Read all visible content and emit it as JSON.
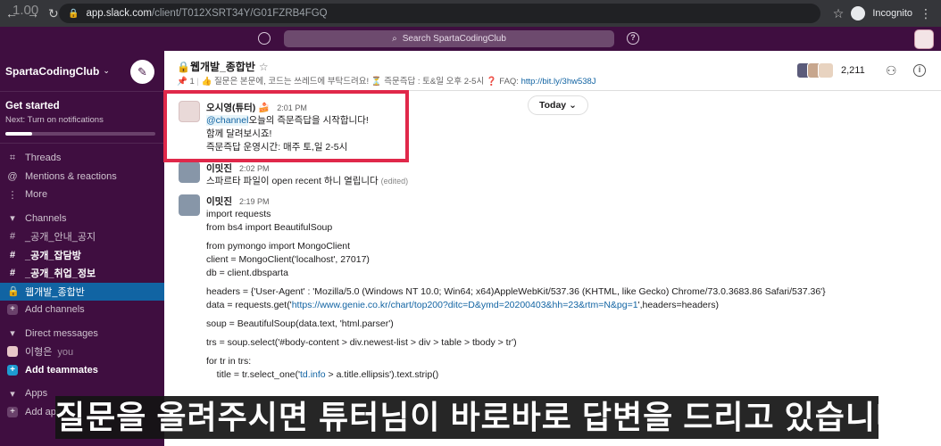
{
  "browser": {
    "url_host": "app.slack.com",
    "url_path": "/client/T012XSRT34Y/G01FZRB4FGQ",
    "profile": "Incognito",
    "overlay_version": "1.00"
  },
  "slack_top": {
    "search_placeholder": "Search SpartaCodingClub"
  },
  "sidebar": {
    "workspace": "SpartaCodingClub",
    "get_started_title": "Get started",
    "get_started_sub": "Next: Turn on notifications",
    "get_started_progress": 0.18,
    "nav": [
      {
        "label": "Threads",
        "icon": "threads-icon"
      },
      {
        "label": "Mentions & reactions",
        "icon": "at-icon"
      },
      {
        "label": "More",
        "icon": "more-icon"
      }
    ],
    "channels_header": "Channels",
    "channels": [
      {
        "label": "_공개_안내_공지",
        "bold": false,
        "active": false,
        "prefix": "#"
      },
      {
        "label": "_공개_잡담방",
        "bold": true,
        "active": false,
        "prefix": "#"
      },
      {
        "label": "_공개_취업_정보",
        "bold": true,
        "active": false,
        "prefix": "#"
      },
      {
        "label": "웹개발_종합반",
        "bold": false,
        "active": true,
        "prefix": "🔒"
      }
    ],
    "add_channels": "Add channels",
    "dm_header": "Direct messages",
    "dm_user": "이형은",
    "dm_you": "you",
    "add_teammates": "Add teammates",
    "apps_header": "Apps",
    "add_apps": "Add apps"
  },
  "channel": {
    "name": "웹개발_종합반",
    "topic_count": "1",
    "topic_text": "👍 질문은 본문에, 코드는 쓰레드에 부탁드려요! ⏳ 즉문즉답 : 토&일 오후 2-5시 ❓ FAQ: ",
    "topic_link": "http://bit.ly/3hw538J",
    "member_count": "2,211"
  },
  "today_label": "Today",
  "messages": {
    "m1": {
      "author": "오시영(튜터) 🍰",
      "time": "2:01 PM",
      "mention": "@channel",
      "line1_rest": "오늘의 즉문즉답을 시작합니다!",
      "line2": "함께 달려보시죠!",
      "line3": "즉문즉답 운영시간: 매주 토,일 2-5시"
    },
    "m2": {
      "author": "이밋진",
      "time": "2:02 PM",
      "line1": "스파르타 파일이 open recent 하니 열립니다",
      "edited": "(edited)"
    },
    "m3": {
      "author": "이밋진",
      "time": "2:19 PM",
      "c1": "import requests",
      "c2": "from bs4 import BeautifulSoup",
      "c3": "from pymongo import MongoClient",
      "c4": "client = MongoClient('localhost', 27017)",
      "c5": "db = client.dbsparta",
      "c6": "headers = {'User-Agent' : 'Mozilla/5.0 (Windows NT 10.0; Win64; x64)AppleWebKit/537.36 (KHTML, like Gecko) Chrome/73.0.3683.86 Safari/537.36'}",
      "c7_pre": "data = requests.get('",
      "c7_link": "https://www.genie.co.kr/chart/top200?ditc=D&ymd=20200403&hh=23&rtm=N&pg=1",
      "c7_post": "',headers=headers)",
      "c8": "soup = BeautifulSoup(data.text, 'html.parser')",
      "c9": "trs = soup.select('#body-content > div.newest-list > div > table > tbody > tr')",
      "c10": "for tr in trs:",
      "c11_pre": "    title = tr.select_one('",
      "c11_link": "td.info",
      "c11_post": " > a.title.ellipsis').text.strip()"
    }
  },
  "subtitle": "질문을 올려주시면 튜터님이 바로바로 답변을 드리고 있습니다",
  "colors": {
    "slack_aubergine": "#3f0e40",
    "active_channel": "#1164a3",
    "highlight_box": "#e0284a"
  }
}
